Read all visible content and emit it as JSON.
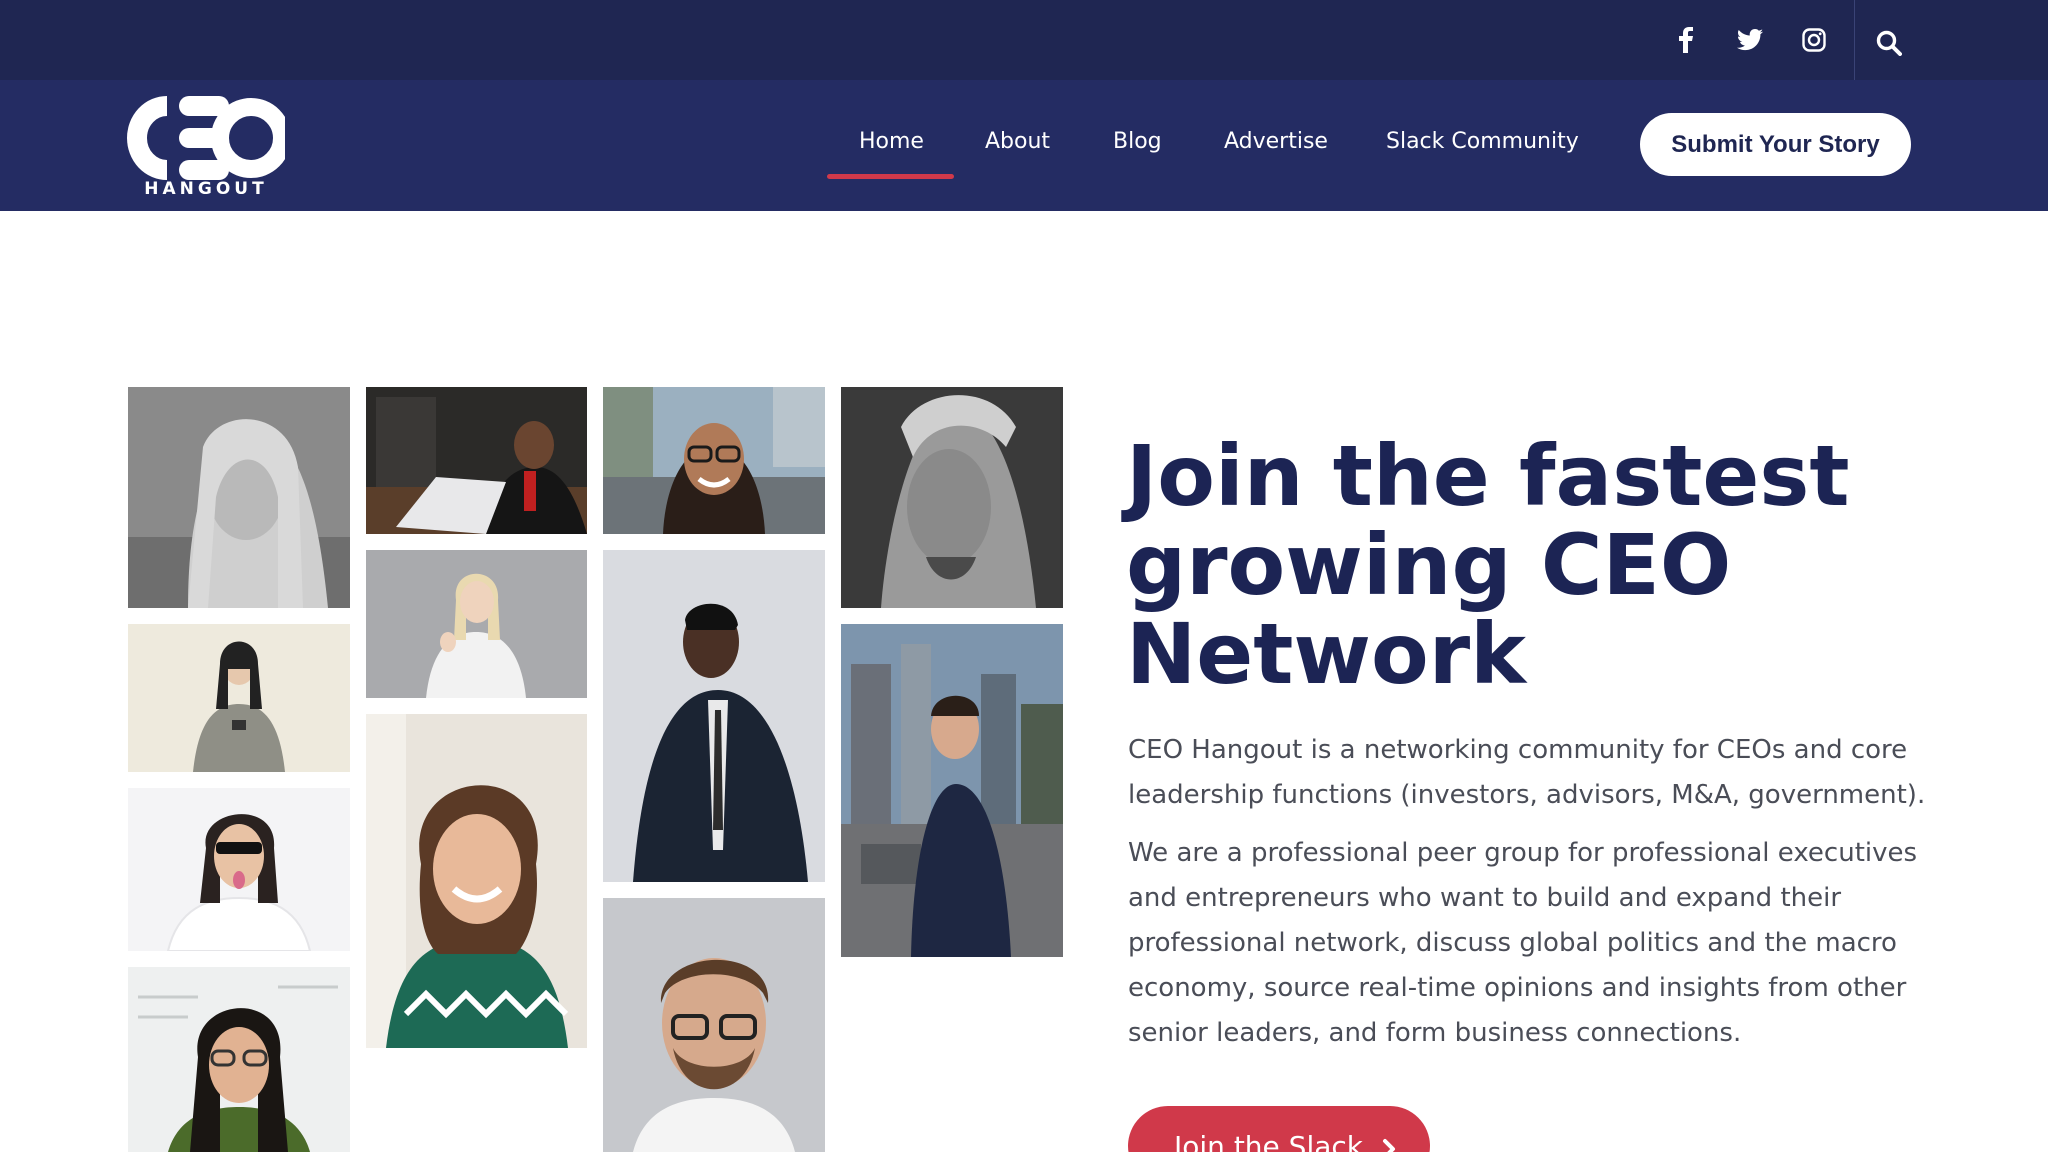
{
  "colors": {
    "topbar_bg": "#1f2652",
    "navbar_bg": "#242c63",
    "accent_red": "#d0394a",
    "heading_navy": "#1c2454",
    "body_text": "#4a4d57"
  },
  "topbar": {
    "icons": [
      "facebook-icon",
      "twitter-icon",
      "instagram-icon",
      "search-icon"
    ]
  },
  "logo": {
    "wordmark": "CEO",
    "subtitle": "HANGOUT"
  },
  "nav": {
    "items": [
      {
        "label": "Home",
        "active": true
      },
      {
        "label": "About"
      },
      {
        "label": "Blog"
      },
      {
        "label": "Advertise"
      },
      {
        "label": "Slack Community"
      }
    ],
    "submit_label": "Submit Your Story"
  },
  "hero": {
    "title": "Join the fastest growing CEO Network",
    "paragraph1": "CEO Hangout is a networking community for CEOs and core leadership functions (investors, advisors, M&A, government).",
    "paragraph2": "We are a professional peer group for professional executives and entrepreneurs who want to build and expand their professional network, discuss global politics and the macro economy, source real-time opinions and insights from other senior leaders, and form business connections.",
    "cta_label": "Join the Slack"
  }
}
